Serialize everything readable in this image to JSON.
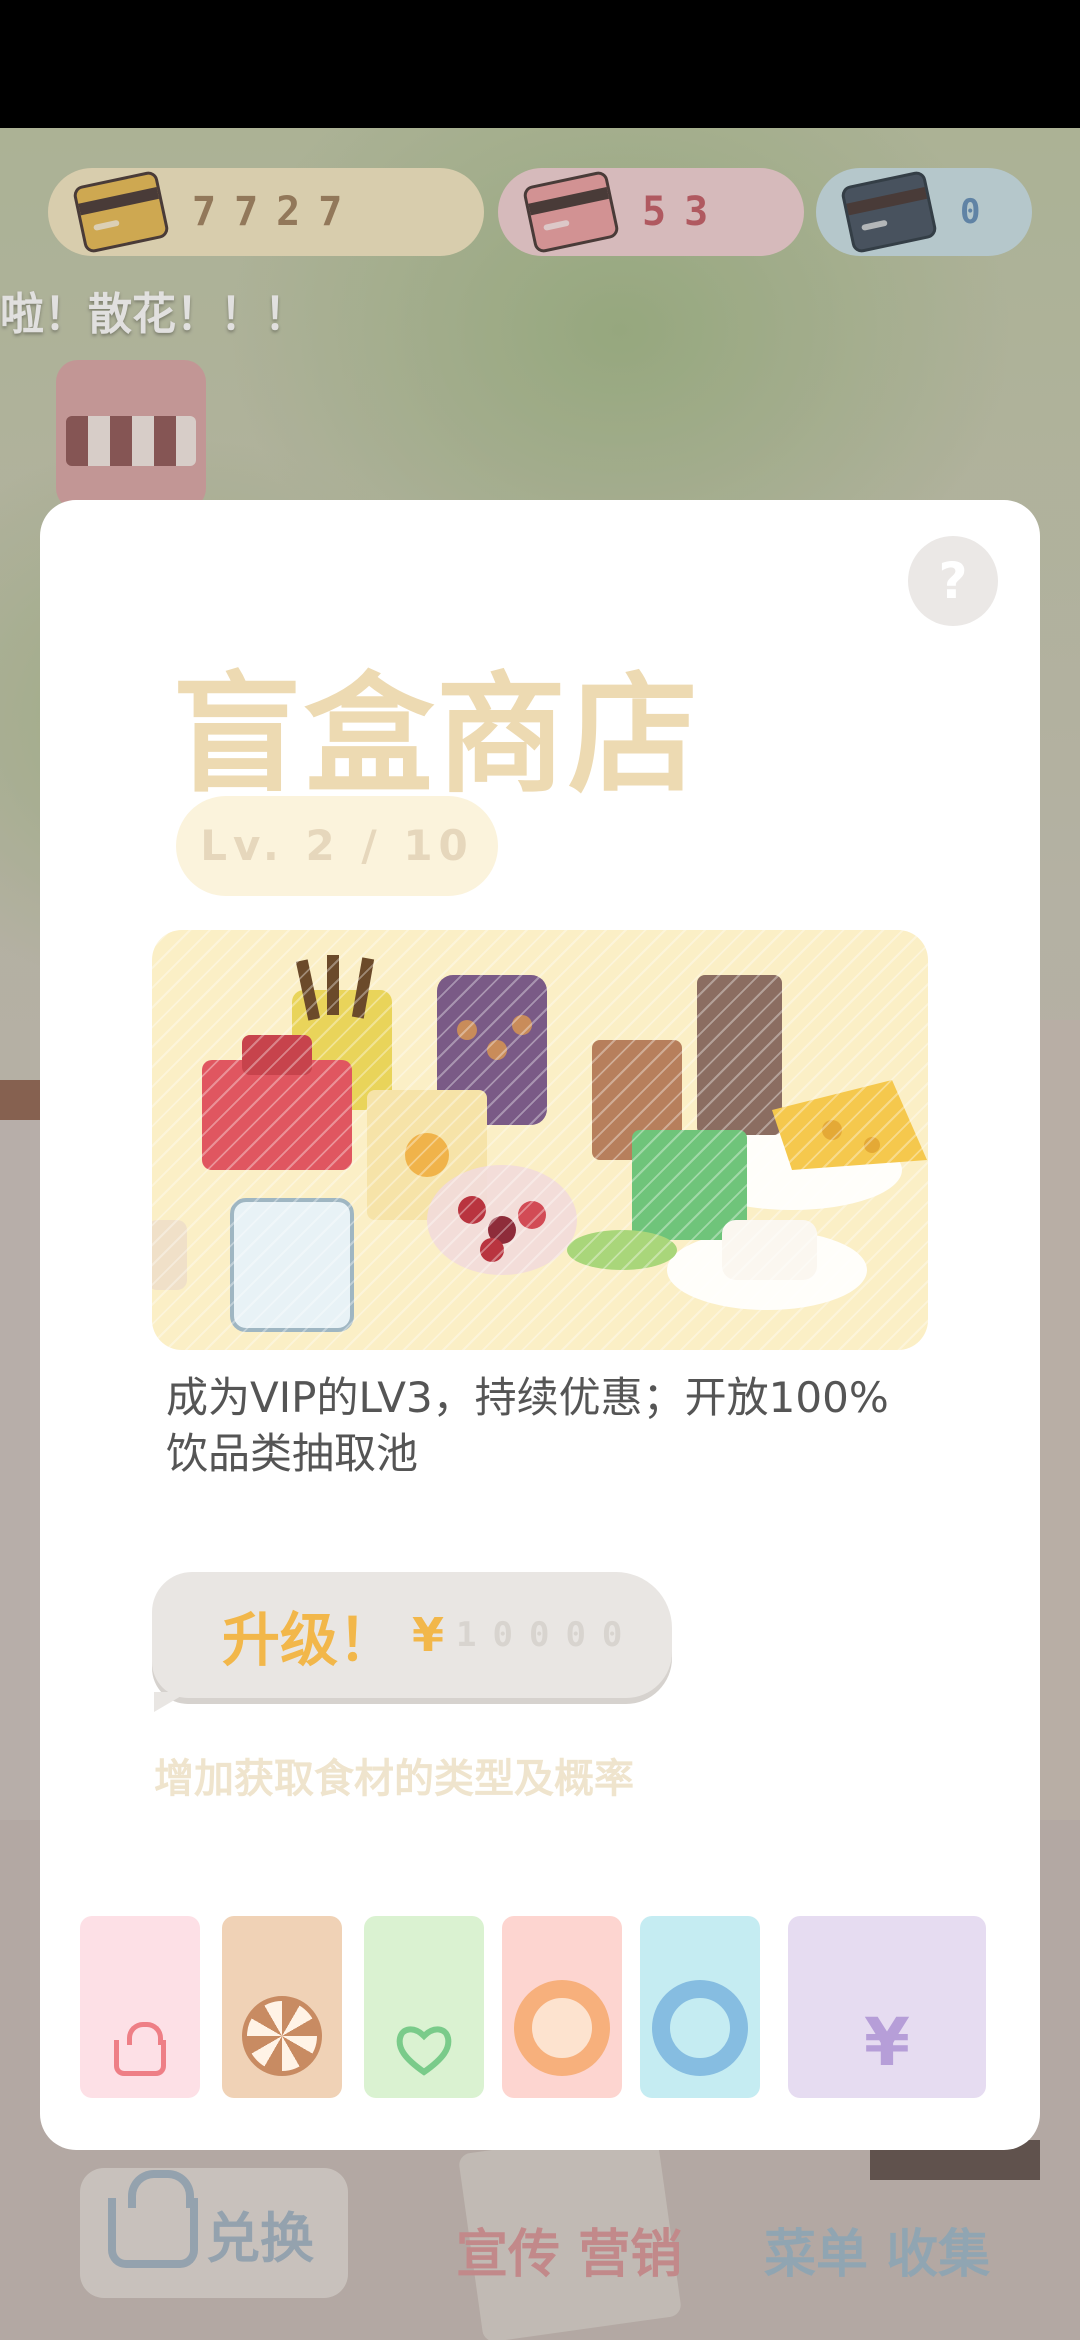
{
  "currency": {
    "gold": "7727",
    "pink": "53",
    "blue": "0"
  },
  "ticker": "啦！散花！！！",
  "background_nav": {
    "exchange": "兑换",
    "promote": "宣传 营销",
    "menu": "菜单 收集"
  },
  "modal": {
    "help_icon": "?",
    "title": "盲盒商店",
    "level": "Lv. 2 / 10",
    "description": "成为VIP的LV3，持续优惠；开放100%饮品类抽取池",
    "upgrade": {
      "label": "升级！",
      "currency_symbol": "¥",
      "price": "10000"
    },
    "hint": "增加获取食材的类型及概率"
  },
  "tabs": [
    {
      "icon": "basket-icon",
      "color": "#ee7f86"
    },
    {
      "icon": "wheel-icon",
      "color": "#c88b62"
    },
    {
      "icon": "heart-icon",
      "color": "#7acb8a"
    },
    {
      "icon": "ring-icon",
      "color": "#f7b07c"
    },
    {
      "icon": "ring-icon",
      "color": "#86bde1"
    },
    {
      "icon": "yen-icon",
      "color": "#b69ed8",
      "glyph": "¥"
    }
  ],
  "colors": {
    "title": "#eddab2",
    "upgrade": "#f2b74a",
    "modal_bg": "#ffffff"
  }
}
